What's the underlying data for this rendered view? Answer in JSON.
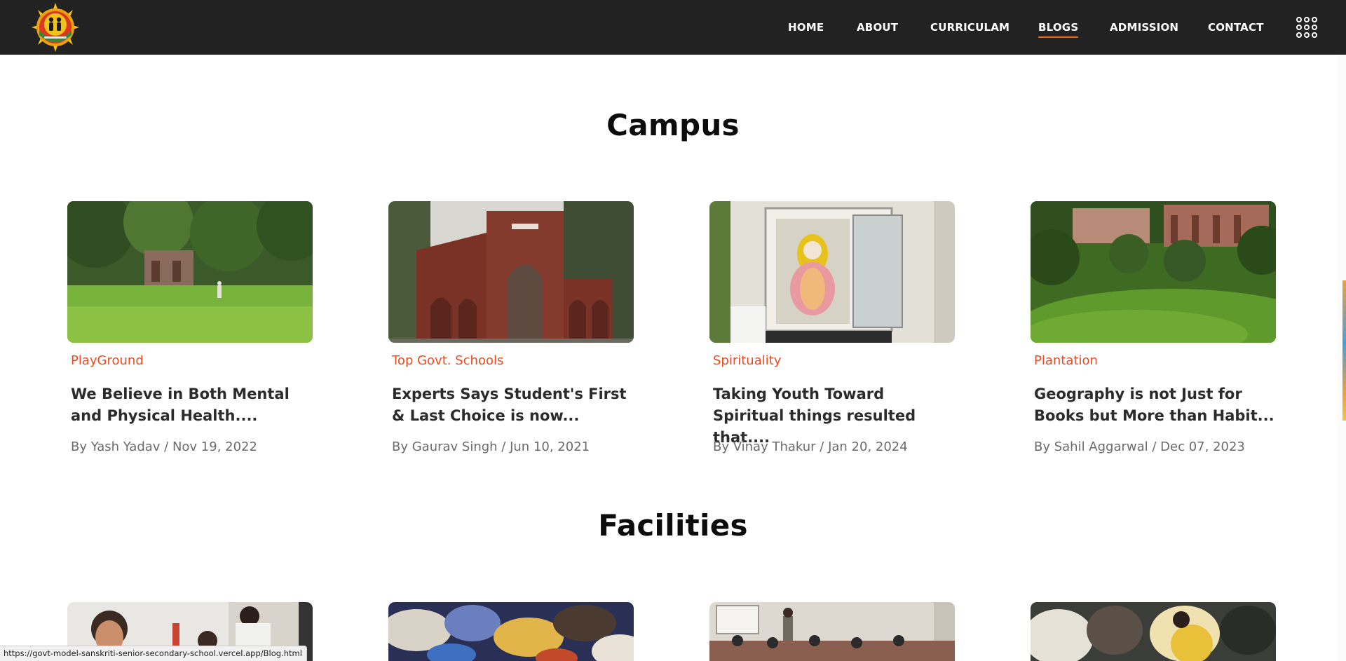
{
  "header": {
    "logo": "school-logo",
    "nav": [
      {
        "label": "HOME",
        "active": false
      },
      {
        "label": "ABOUT",
        "active": false
      },
      {
        "label": "CURRICULAM",
        "active": false
      },
      {
        "label": "BLOGS",
        "active": true
      },
      {
        "label": "ADMISSION",
        "active": false
      },
      {
        "label": "CONTACT",
        "active": false
      }
    ],
    "menu_icon": "grid-menu-icon",
    "accent_color": "#f26a21"
  },
  "sections": {
    "campus": {
      "title": "Campus",
      "cards": [
        {
          "category": "PlayGround",
          "title": "We Believe in Both Mental and Physical Health....",
          "meta": "By Yash Yadav / Nov 19, 2022"
        },
        {
          "category": "Top Govt. Schools",
          "title": "Experts Says Student's First & Last Choice is now...",
          "meta": "By Gaurav Singh / Jun 10, 2021"
        },
        {
          "category": "Spirituality",
          "title": "Taking Youth Toward Spiritual things resulted that....",
          "meta": "By Vinay Thakur / Jan 20, 2024"
        },
        {
          "category": "Plantation",
          "title": "Geography is not Just for Books but More than Habit...",
          "meta": "By Sahil Aggarwal / Dec 07, 2023"
        }
      ]
    },
    "facilities": {
      "title": "Facilities"
    }
  },
  "status_bar": {
    "url": "https://govt-model-sanskriti-senior-secondary-school.vercel.app/Blog.html"
  },
  "colors": {
    "header_bg": "#222222",
    "category": "#f1481f",
    "title": "#2b2b2b",
    "meta": "#6b6b6b"
  }
}
